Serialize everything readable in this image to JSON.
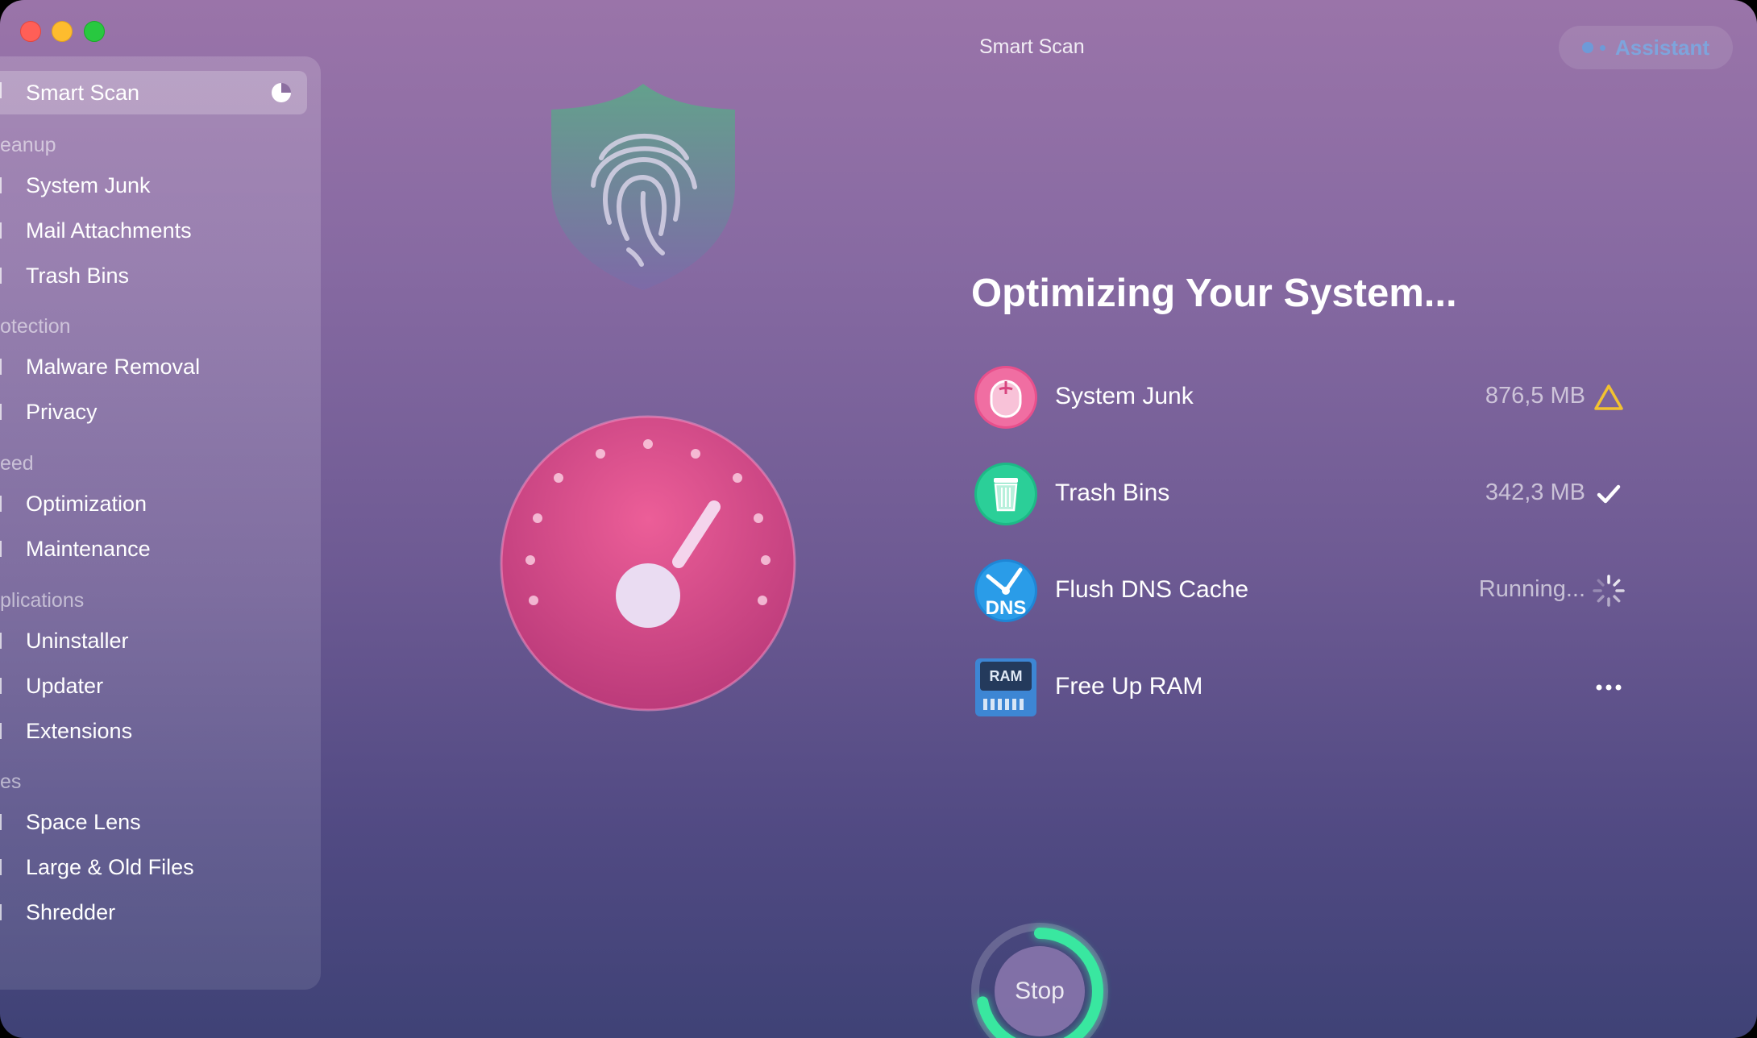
{
  "window": {
    "title": "Smart Scan",
    "assistant_label": "Assistant"
  },
  "sidebar": {
    "active": {
      "label": "Smart Scan"
    },
    "sections": [
      {
        "label": "eanup",
        "items": [
          {
            "label": "System Junk"
          },
          {
            "label": "Mail Attachments"
          },
          {
            "label": "Trash Bins"
          }
        ]
      },
      {
        "label": "otection",
        "items": [
          {
            "label": "Malware Removal"
          },
          {
            "label": "Privacy"
          }
        ]
      },
      {
        "label": "eed",
        "items": [
          {
            "label": "Optimization"
          },
          {
            "label": "Maintenance"
          }
        ]
      },
      {
        "label": "plications",
        "items": [
          {
            "label": "Uninstaller"
          },
          {
            "label": "Updater"
          },
          {
            "label": "Extensions"
          }
        ]
      },
      {
        "label": "es",
        "items": [
          {
            "label": "Space Lens"
          },
          {
            "label": "Large & Old Files"
          },
          {
            "label": "Shredder"
          }
        ]
      }
    ]
  },
  "main": {
    "heading": "Optimizing Your System...",
    "tasks": [
      {
        "name": "System Junk",
        "size": "876,5 MB",
        "status": "warning-icon"
      },
      {
        "name": "Trash Bins",
        "size": "342,3 MB",
        "status": "checkmark-icon"
      },
      {
        "name": "Flush DNS Cache",
        "size": "Running...",
        "status": "spinner-icon",
        "icon_text": "DNS"
      },
      {
        "name": "Free Up RAM",
        "size": "",
        "status": "ellipsis-icon",
        "icon_text": "RAM"
      }
    ],
    "stop_label": "Stop",
    "progress_fraction": 0.72
  },
  "colors": {
    "warning": "#f2c230",
    "accent_green": "#39e7a0",
    "assistant": "#7ea4dc"
  }
}
